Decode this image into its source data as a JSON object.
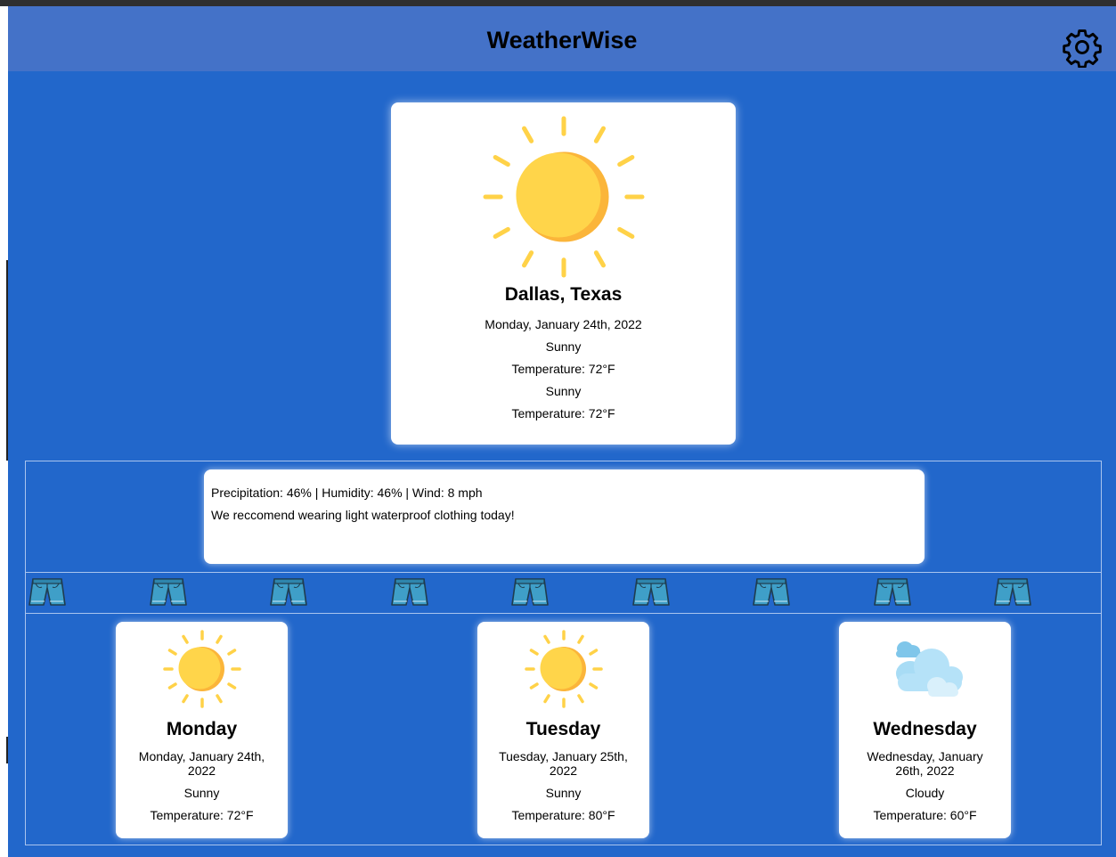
{
  "app": {
    "title": "WeatherWise",
    "settings_icon": "gear-icon",
    "background_color": "#2267cb",
    "header_color": "#4472c8"
  },
  "current": {
    "icon": "sun-icon",
    "city": "Dallas, Texas",
    "date": "Monday, January 24th, 2022",
    "lines": [
      "Sunny",
      "Temperature: 72°F",
      "Sunny",
      "Temperature: 72°F"
    ]
  },
  "details": {
    "stats": "Precipitation: 46% | Humidity: 46% | Wind: 8 mph",
    "recommendation": "We reccomend wearing light waterproof clothing today!"
  },
  "clothing": {
    "icon": "shorts-icon",
    "count": 9
  },
  "forecast": [
    {
      "icon": "sun-icon",
      "day": "Monday",
      "date": "Monday, January 24th, 2022",
      "condition": "Sunny",
      "temperature": "Temperature: 72°F"
    },
    {
      "icon": "sun-icon",
      "day": "Tuesday",
      "date": "Tuesday, January 25th, 2022",
      "condition": "Sunny",
      "temperature": "Temperature: 80°F"
    },
    {
      "icon": "cloud-icon",
      "day": "Wednesday",
      "date": "Wednesday, January 26th, 2022",
      "condition": "Cloudy",
      "temperature": "Temperature: 60°F"
    }
  ]
}
